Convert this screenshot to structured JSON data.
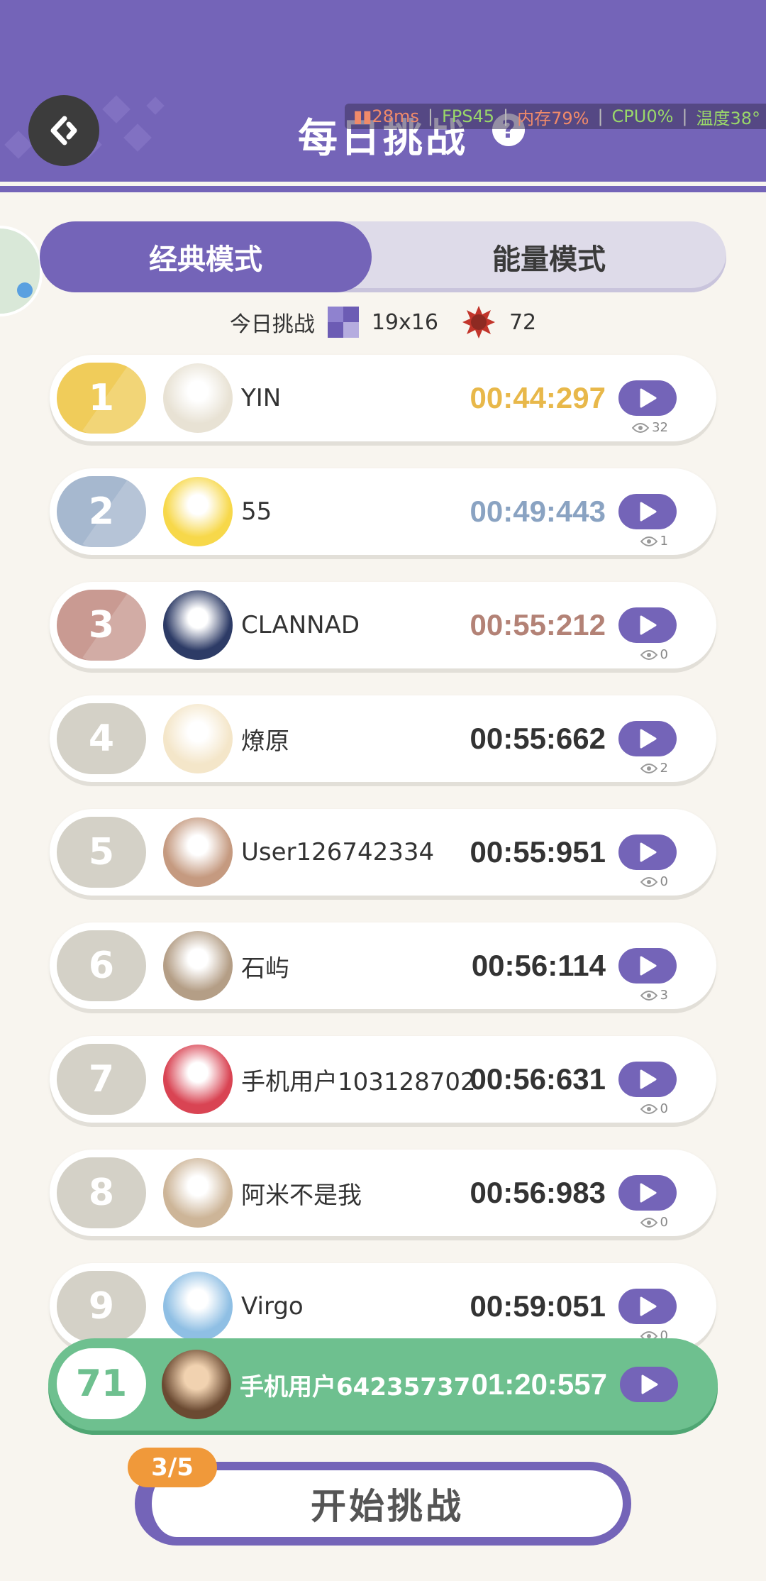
{
  "header": {
    "title": "每日挑战",
    "help_symbol": "?"
  },
  "perf": {
    "ping": "28ms",
    "fps": "FPS45",
    "memory": "内存79%",
    "cpu": "CPU0%",
    "temp": "温度38°"
  },
  "tabs": [
    {
      "label": "经典模式",
      "active": true
    },
    {
      "label": "能量模式",
      "active": false
    }
  ],
  "today": {
    "label": "今日挑战",
    "grid_size": "19x16",
    "energy": "72"
  },
  "leaderboard": [
    {
      "rank": "1",
      "name": "YIN",
      "time": "00:44:297",
      "views": "32",
      "rank_color": "#f0cc5a",
      "time_color": "#e8b84a",
      "avatar_color": "#e8e2d4"
    },
    {
      "rank": "2",
      "name": "55",
      "time": "00:49:443",
      "views": "1",
      "rank_color": "#a6b8cf",
      "time_color": "#8aa3c2",
      "avatar_color": "#f7d84a"
    },
    {
      "rank": "3",
      "name": "CLANNAD",
      "time": "00:55:212",
      "views": "0",
      "rank_color": "#c99a92",
      "time_color": "#b38276",
      "avatar_color": "#2d3b66"
    },
    {
      "rank": "4",
      "name": "燎原",
      "time": "00:55:662",
      "views": "2",
      "rank_color": "#d4d1c7",
      "time_color": "#333333",
      "avatar_color": "#f4e6c9"
    },
    {
      "rank": "5",
      "name": "User126742334",
      "time": "00:55:951",
      "views": "0",
      "rank_color": "#d4d1c7",
      "time_color": "#333333",
      "avatar_color": "#c59a80"
    },
    {
      "rank": "6",
      "name": "石屿",
      "time": "00:56:114",
      "views": "3",
      "rank_color": "#d4d1c7",
      "time_color": "#333333",
      "avatar_color": "#b49e86"
    },
    {
      "rank": "7",
      "name": "手机用户103128702",
      "time": "00:56:631",
      "views": "0",
      "rank_color": "#d4d1c7",
      "time_color": "#333333",
      "avatar_color": "#d94453"
    },
    {
      "rank": "8",
      "name": "阿米不是我",
      "time": "00:56:983",
      "views": "0",
      "rank_color": "#d4d1c7",
      "time_color": "#333333",
      "avatar_color": "#cdb598"
    },
    {
      "rank": "9",
      "name": "Virgo",
      "time": "00:59:051",
      "views": "0",
      "rank_color": "#d4d1c7",
      "time_color": "#333333",
      "avatar_color": "#8fbfe4"
    }
  ],
  "my_entry": {
    "rank": "71",
    "name": "手机用户64235737",
    "time": "01:20:557",
    "avatar_color": "#6b4a32"
  },
  "start": {
    "label": "开始挑战",
    "counter": "3/5"
  },
  "colors": {
    "primary": "#7464b8",
    "green": "#6ec08f",
    "orange": "#f0993a"
  }
}
